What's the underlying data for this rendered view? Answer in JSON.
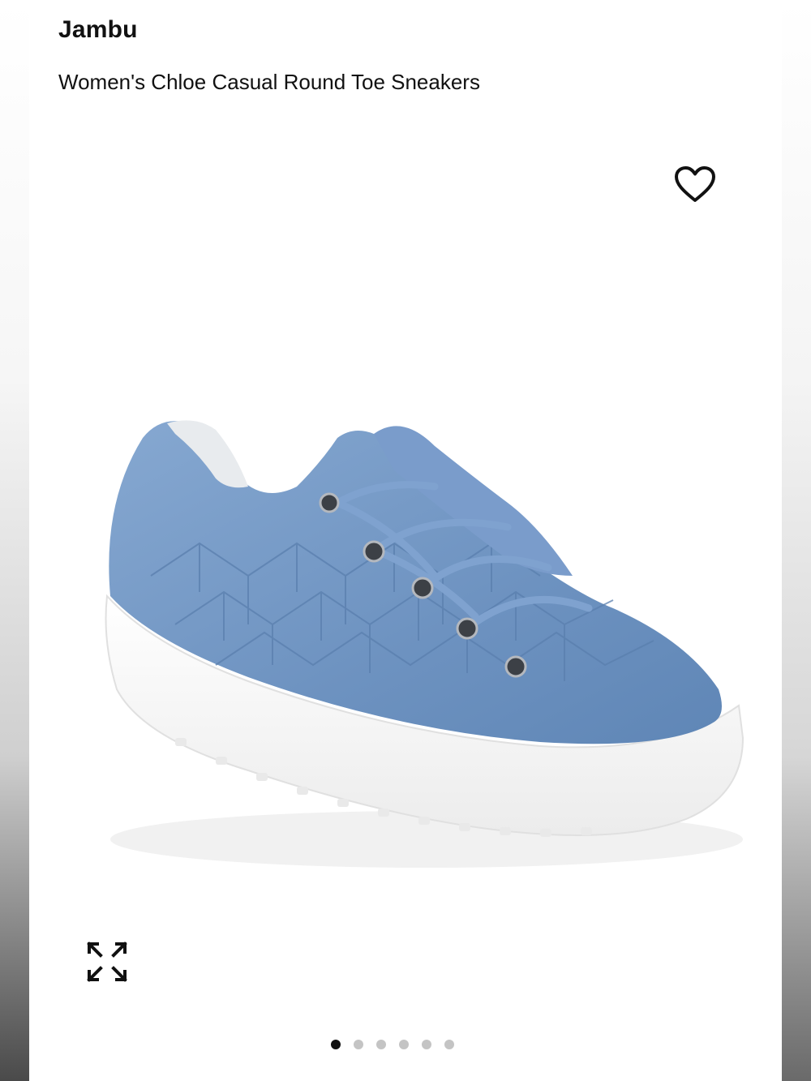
{
  "product": {
    "brand": "Jambu",
    "title": "Women's Chloe Casual Round Toe Sneakers"
  },
  "gallery": {
    "image_icon": "blue-suede-woven-sneaker",
    "favorite_icon": "heart-outline-icon",
    "expand_icon": "expand-arrows-icon",
    "slide_count": 6,
    "active_slide": 1
  },
  "colors": {
    "suede": "#6f95c2",
    "sole": "#ffffff",
    "text": "#111111"
  }
}
